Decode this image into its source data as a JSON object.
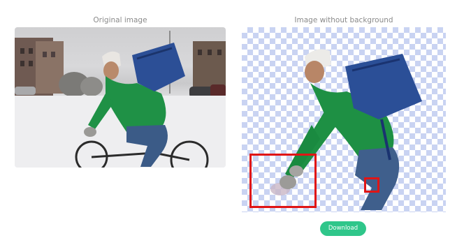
{
  "labels": {
    "original": "Original image",
    "without_background": "Image without background"
  },
  "actions": {
    "download_label": "Download"
  },
  "colors": {
    "accent_button": "#2fc68a",
    "highlight_marker": "#e01515",
    "checker_light": "#ffffff",
    "checker_dark": "#c9d3f2"
  }
}
